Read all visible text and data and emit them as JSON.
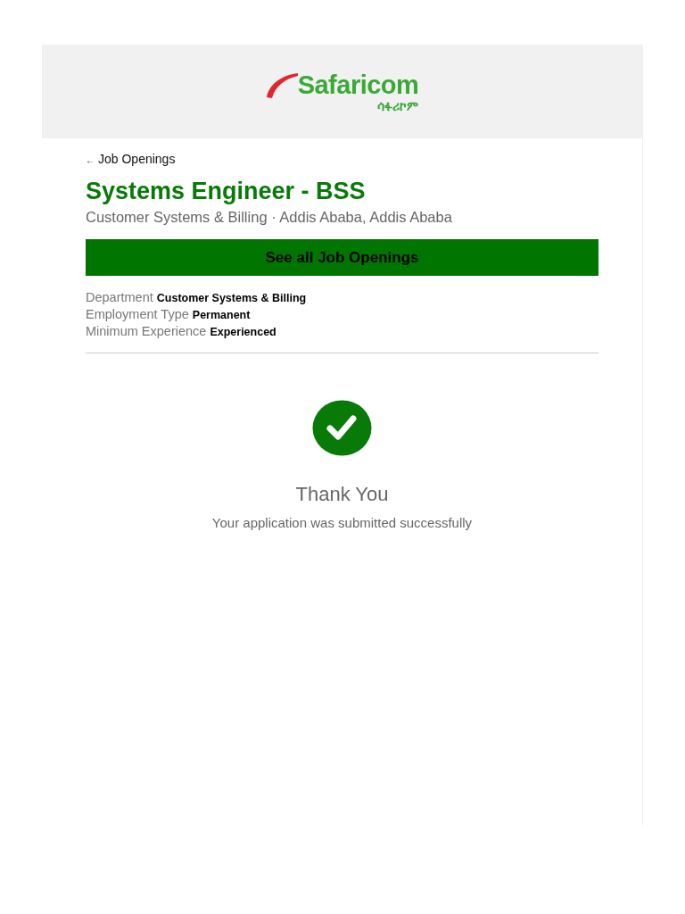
{
  "header": {
    "logo_text": "Safaricom",
    "logo_subtext": "ሳፋሪኮም"
  },
  "back_link": {
    "icon": "←",
    "label": "Job Openings"
  },
  "job": {
    "title": "Systems Engineer - BSS",
    "subtitle": "Customer Systems & Billing · Addis Ababa, Addis Ababa"
  },
  "button": "See all Job Openings",
  "details": [
    {
      "label": "Department",
      "value": "Customer Systems & Billing"
    },
    {
      "label": "Employment Type",
      "value": "Permanent"
    },
    {
      "label": "Minimum Experience",
      "value": "Experienced"
    }
  ],
  "confirmation": {
    "title": "Thank You",
    "message": "Your application was submitted successfully"
  }
}
